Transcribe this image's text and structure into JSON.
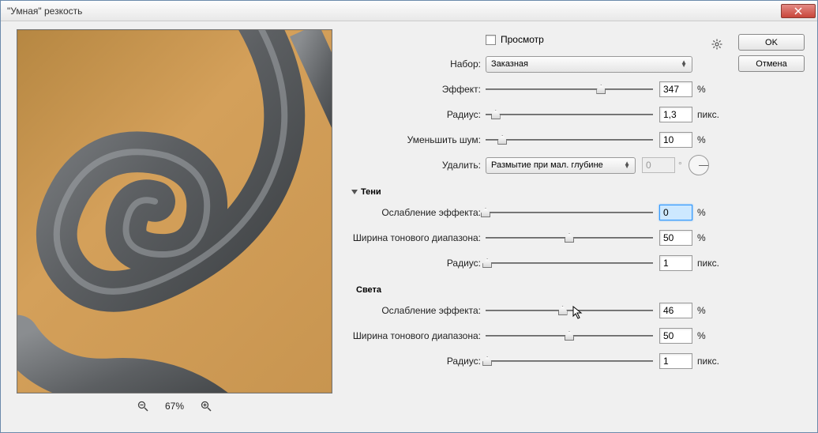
{
  "window": {
    "title": "\"Умная\" резкость"
  },
  "buttons": {
    "ok": "OK",
    "cancel": "Отмена"
  },
  "preview": {
    "checkbox_label": "Просмотр",
    "zoom": "67%"
  },
  "main": {
    "preset_label": "Набор:",
    "preset_value": "Заказная",
    "amount_label": "Эффект:",
    "amount_value": "347",
    "amount_unit": "%",
    "radius_label": "Радиус:",
    "radius_value": "1,3",
    "radius_unit": "пикс.",
    "noise_label": "Уменьшить шум:",
    "noise_value": "10",
    "noise_unit": "%",
    "remove_label": "Удалить:",
    "remove_value": "Размытие при мал. глубине",
    "angle_value": "0"
  },
  "shadows": {
    "title": "Тени",
    "fade_label": "Ослабление эффекта:",
    "fade_value": "0",
    "fade_unit": "%",
    "tonal_label": "Ширина тонового диапазона:",
    "tonal_value": "50",
    "tonal_unit": "%",
    "radius_label": "Радиус:",
    "radius_value": "1",
    "radius_unit": "пикс."
  },
  "highlights": {
    "title": "Света",
    "fade_label": "Ослабление эффекта:",
    "fade_value": "46",
    "fade_unit": "%",
    "tonal_label": "Ширина тонового диапазона:",
    "tonal_value": "50",
    "tonal_unit": "%",
    "radius_label": "Радиус:",
    "radius_value": "1",
    "radius_unit": "пикс."
  }
}
